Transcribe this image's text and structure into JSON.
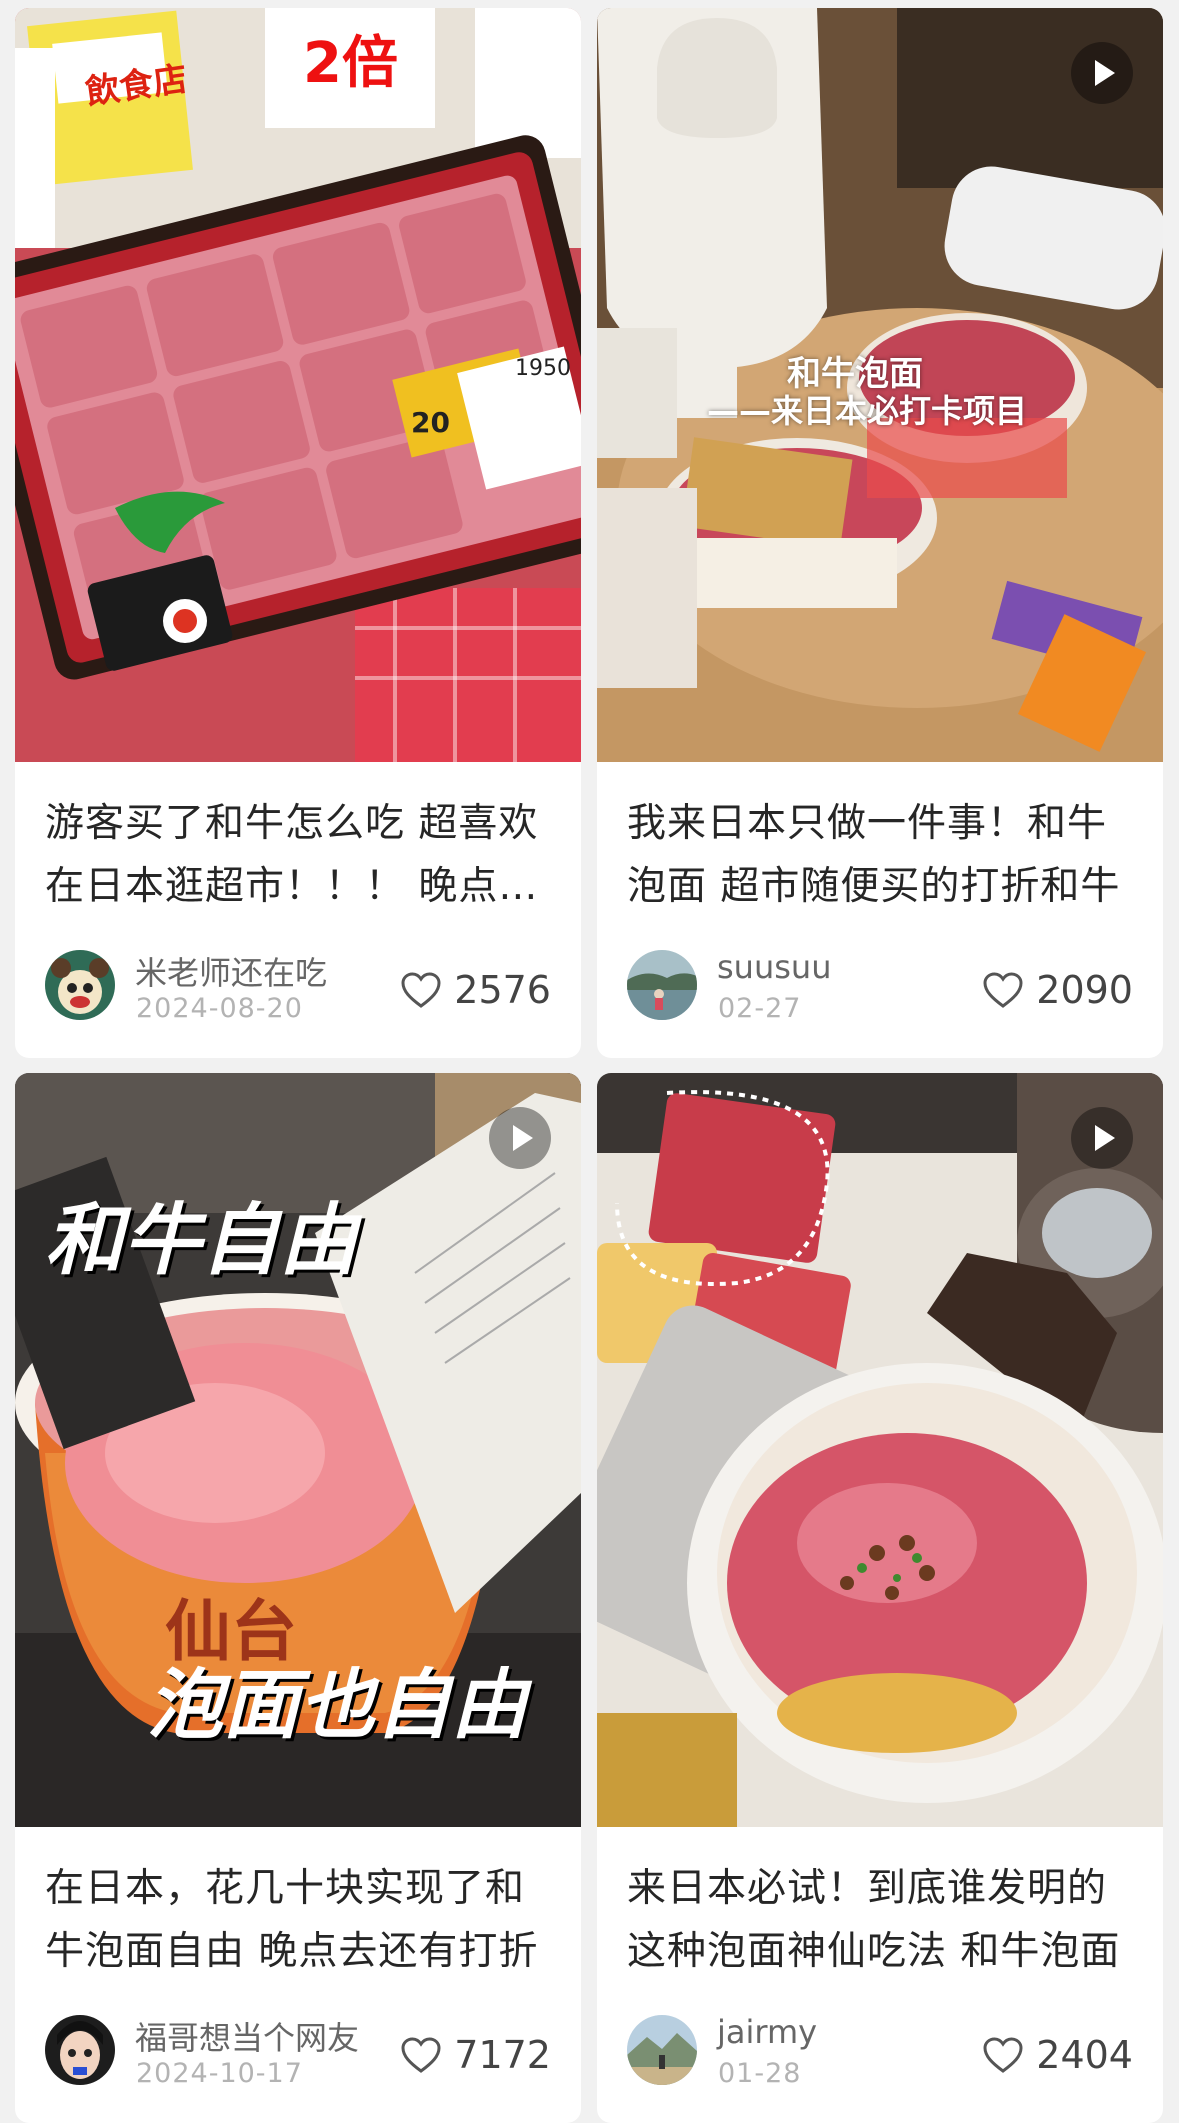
{
  "feed": {
    "cards": [
      {
        "title": "游客买了和牛怎么吃 超喜欢在日本逛超市！！！ 晚点去还有半价的",
        "author": "米老师还在吃",
        "date": "2024-08-20",
        "likes": "2576",
        "has_video": false,
        "cover_texts": {
          "sign1": "飲食店",
          "sign2": "2倍",
          "price": "1950",
          "tag": "20"
        }
      },
      {
        "title": "我来日本只做一件事！和牛泡面 超市随便买的打折和牛",
        "author": "suusuu",
        "date": "02-27",
        "likes": "2090",
        "has_video": true,
        "cover_texts": {
          "line1": "和牛泡面",
          "line2": "——来日本必打卡项目"
        }
      },
      {
        "title": "在日本，花几十块实现了和牛泡面自由 晚点去还有打折",
        "author": "福哥想当个网友",
        "date": "2024-10-17",
        "likes": "7172",
        "has_video": true,
        "cover_texts": {
          "line1": "和牛自由",
          "line2": "泡面也自由",
          "cup": "仙台"
        }
      },
      {
        "title": "来日本必试！到底谁发明的这种泡面神仙吃法 和牛泡面",
        "author": "jairmy",
        "date": "01-28",
        "likes": "2404",
        "has_video": true,
        "cover_texts": {}
      }
    ]
  },
  "colors": {
    "background": "#f1f1f1",
    "card": "#ffffff",
    "title": "#262626",
    "author": "#666666",
    "date": "#b3b3b3"
  },
  "icons": {
    "like": "heart-outline-icon",
    "video": "play-icon"
  }
}
